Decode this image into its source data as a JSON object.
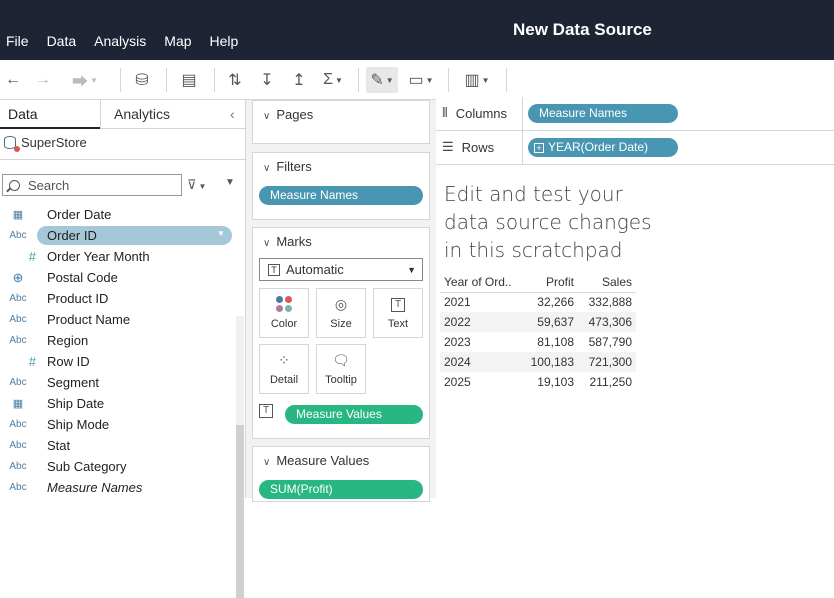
{
  "window": {
    "title": "New Data Source"
  },
  "menu": [
    "File",
    "Data",
    "Analysis",
    "Map",
    "Help"
  ],
  "left": {
    "tabs": {
      "data": "Data",
      "analytics": "Analytics"
    },
    "datasource": "SuperStore",
    "search": {
      "placeholder": "Search"
    },
    "fields": [
      {
        "icon": "calendar-icon",
        "name": "Order Date"
      },
      {
        "icon": "abc-icon",
        "name": "Order ID",
        "selected": true
      },
      {
        "icon": "number-icon",
        "name": "Order Year Month"
      },
      {
        "icon": "globe-icon",
        "name": "Postal Code"
      },
      {
        "icon": "abc-icon",
        "name": "Product ID"
      },
      {
        "icon": "abc-icon",
        "name": "Product Name"
      },
      {
        "icon": "abc-icon",
        "name": "Region"
      },
      {
        "icon": "number-icon",
        "name": "Row ID"
      },
      {
        "icon": "abc-icon",
        "name": "Segment"
      },
      {
        "icon": "calendar-icon",
        "name": "Ship Date"
      },
      {
        "icon": "abc-icon",
        "name": "Ship Mode"
      },
      {
        "icon": "abc-icon",
        "name": "Stat"
      },
      {
        "icon": "abc-icon",
        "name": "Sub Category"
      },
      {
        "icon": "abc-icon",
        "name": "Measure Names",
        "italic": true
      }
    ]
  },
  "cards": {
    "pages": "Pages",
    "filters": {
      "title": "Filters",
      "pill": "Measure Names"
    },
    "marks": {
      "title": "Marks",
      "type": "Automatic",
      "buttons": {
        "color": "Color",
        "size": "Size",
        "text": "Text",
        "detail": "Detail",
        "tooltip": "Tooltip"
      },
      "text_pill": "Measure Values"
    },
    "measure_values": {
      "title": "Measure Values",
      "pill": "SUM(Profit)"
    }
  },
  "shelves": {
    "columns": {
      "label": "Columns",
      "pill": "Measure Names"
    },
    "rows": {
      "label": "Rows",
      "pill": "YEAR(Order Date)"
    }
  },
  "canvas": {
    "headline": "Edit and test your data source changes in this scratchpad",
    "table": {
      "headers": [
        "Year of Ord..",
        "Profit",
        "Sales"
      ],
      "rows": [
        [
          "2021",
          "32,266",
          "332,888"
        ],
        [
          "2022",
          "59,637",
          "473,306"
        ],
        [
          "2023",
          "81,108",
          "587,790"
        ],
        [
          "2024",
          "100,183",
          "721,300"
        ],
        [
          "2025",
          "19,103",
          "211,250"
        ]
      ]
    }
  },
  "colors": {
    "titlebar": "#1f2435",
    "dimension_pill": "#4996b2",
    "measure_pill": "#28b682",
    "selected_field": "#a5c8d8"
  }
}
